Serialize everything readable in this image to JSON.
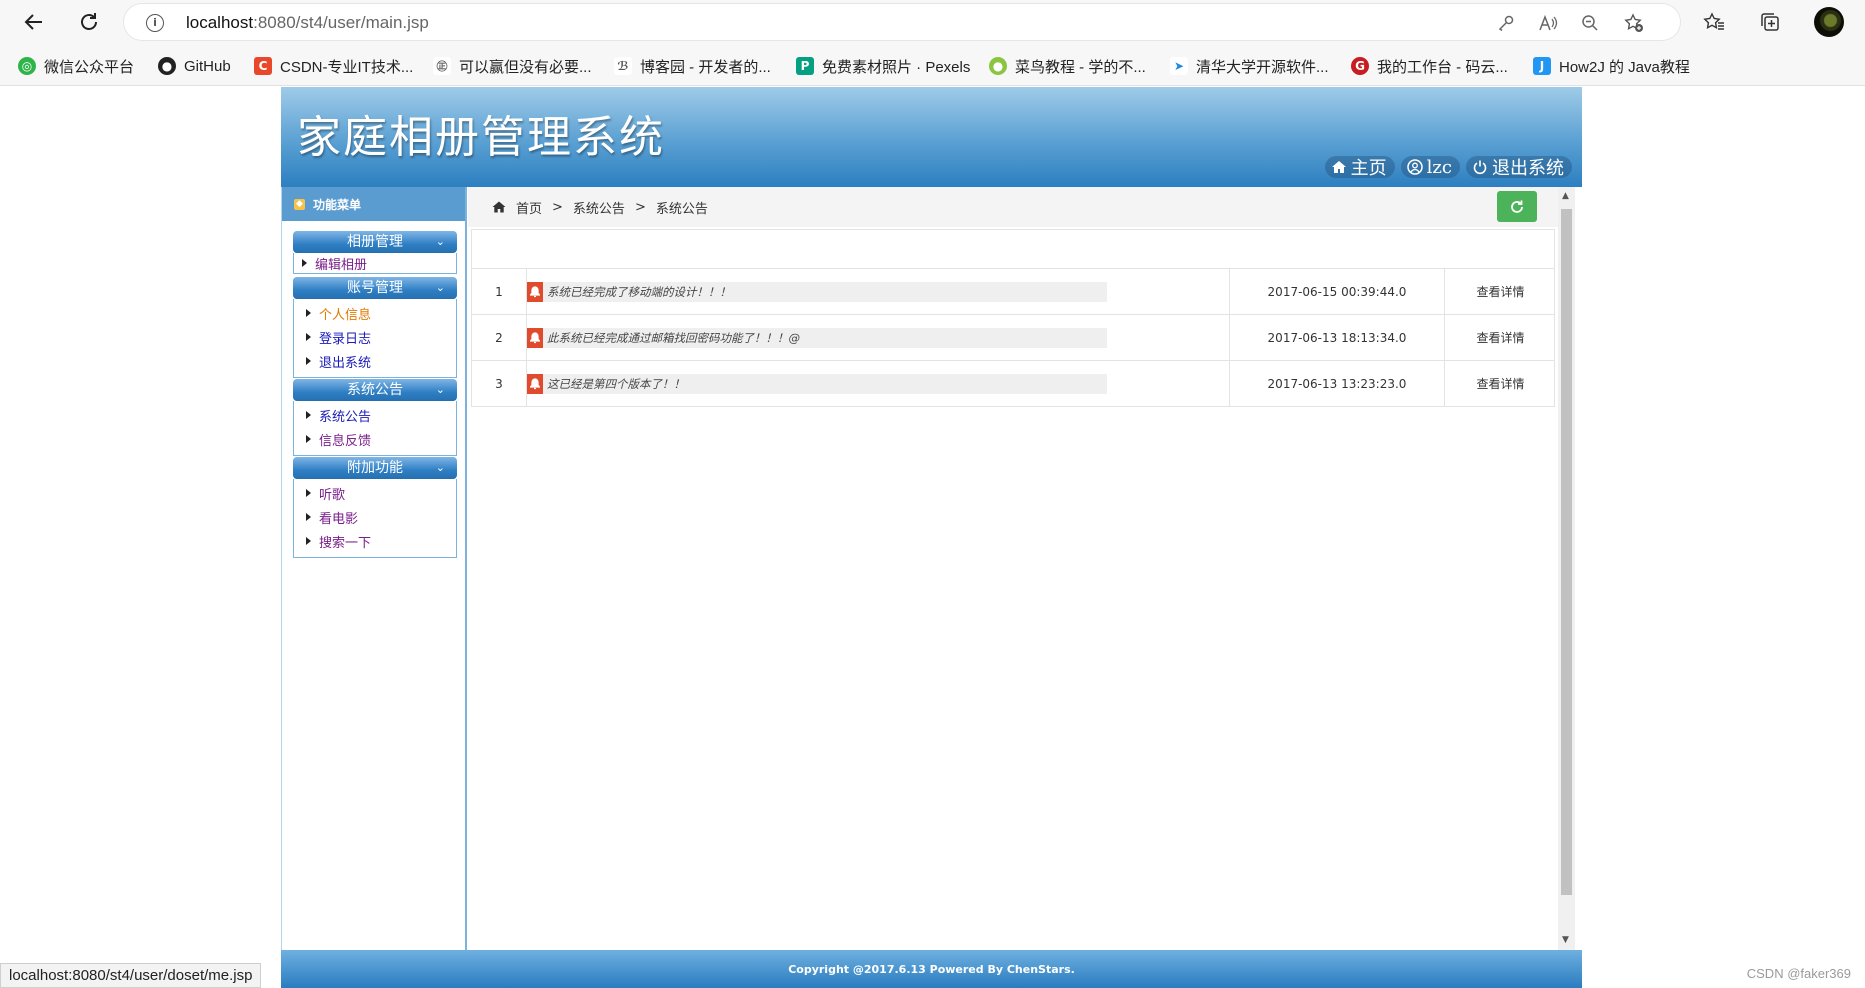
{
  "browser": {
    "url_host": "localhost",
    "url_rest": ":8080/st4/user/main.jsp",
    "status_url": "localhost:8080/st4/user/doset/me.jsp",
    "bookmarks": [
      {
        "label": "微信公众平台",
        "color": "#2fb44a",
        "glyph": "◎"
      },
      {
        "label": "GitHub",
        "color": "#222222",
        "glyph": "●"
      },
      {
        "label": "CSDN-专业IT技术...",
        "color": "#e8472a",
        "glyph": "C"
      },
      {
        "label": "可以赢但没有必要...",
        "color": "#6a6a6a",
        "glyph": "㊣"
      },
      {
        "label": "博客园 - 开发者的...",
        "color": "#555555",
        "glyph": "ℬ"
      },
      {
        "label": "免费素材照片 · Pexels",
        "color": "#05a081",
        "glyph": "P"
      },
      {
        "label": "菜鸟教程 - 学的不...",
        "color": "#8ac53f",
        "glyph": "●"
      },
      {
        "label": "清华大学开源软件...",
        "color": "#1e88e5",
        "glyph": "➤"
      },
      {
        "label": "我的工作台 - 码云...",
        "color": "#c71d23",
        "glyph": "G"
      },
      {
        "label": "How2J 的 Java教程",
        "color": "#2196f3",
        "glyph": "J"
      }
    ]
  },
  "header": {
    "title": "家庭相册管理系统",
    "links": {
      "home": "主页",
      "user": "lzc",
      "logout": "退出系统"
    }
  },
  "sidebar": {
    "title": "功能菜单",
    "groups": [
      {
        "title": "相册管理",
        "items": [
          {
            "label": "编辑相册"
          }
        ]
      },
      {
        "title": "账号管理",
        "items": [
          {
            "label": "个人信息"
          },
          {
            "label": "登录日志"
          },
          {
            "label": "退出系统"
          }
        ]
      },
      {
        "title": "系统公告",
        "items": [
          {
            "label": "系统公告"
          },
          {
            "label": "信息反馈"
          }
        ]
      },
      {
        "title": "附加功能",
        "items": [
          {
            "label": "听歌"
          },
          {
            "label": "看电影"
          },
          {
            "label": "搜索一下"
          }
        ]
      }
    ]
  },
  "breadcrumb": {
    "home": "首页",
    "sep": ">",
    "level1": "系统公告",
    "level2": "系统公告"
  },
  "notices": [
    {
      "no": "1",
      "text": "系统已经完成了移动端的设计！！！",
      "time": "2017-06-15 00:39:44.0",
      "action": "查看详情"
    },
    {
      "no": "2",
      "text": "此系统已经完成通过邮箱找回密码功能了！！！@",
      "time": "2017-06-13 18:13:34.0",
      "action": "查看详情"
    },
    {
      "no": "3",
      "text": "这已经是第四个版本了！！",
      "time": "2017-06-13 13:23:23.0",
      "action": "查看详情"
    }
  ],
  "footer": {
    "text": "Copyright @2017.6.13 Powered By ChenStars."
  },
  "watermark": "CSDN @faker369"
}
